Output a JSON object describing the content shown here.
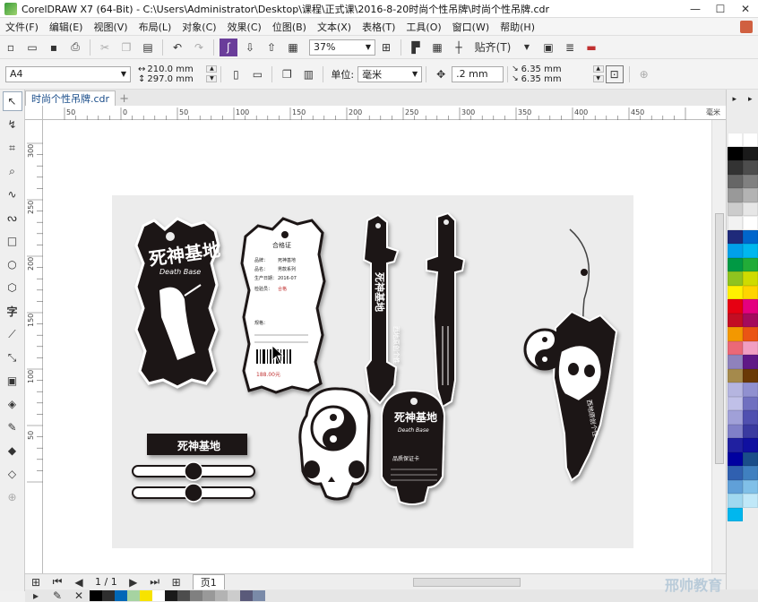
{
  "window": {
    "title": "CorelDRAW X7 (64-Bit) - C:\\Users\\Administrator\\Desktop\\课程\\正式课\\2016-8-20时尚个性吊牌\\时尚个性吊牌.cdr",
    "minimize": "—",
    "maximize": "☐",
    "close": "✕"
  },
  "menu": [
    "文件(F)",
    "编辑(E)",
    "视图(V)",
    "布局(L)",
    "对象(C)",
    "效果(C)",
    "位图(B)",
    "文本(X)",
    "表格(T)",
    "工具(O)",
    "窗口(W)",
    "帮助(H)"
  ],
  "toolbar": {
    "zoom": "37%",
    "snap": "贴齐(T)"
  },
  "property": {
    "paper": "A4",
    "width": "210.0 mm",
    "height": "297.0 mm",
    "unit_label": "单位:",
    "unit": "毫米",
    "nudge": ".2 mm",
    "dup_x": "6.35 mm",
    "dup_y": "6.35 mm"
  },
  "tabs": {
    "doc": "时尚个性吊牌.cdr"
  },
  "ruler": {
    "h_labels": [
      "50",
      "0",
      "50",
      "100",
      "150",
      "200",
      "250",
      "300",
      "350",
      "400",
      "450"
    ],
    "h_unit": "毫米",
    "v_labels": [
      "300",
      "250",
      "200",
      "150",
      "100",
      "50"
    ]
  },
  "status": {
    "page": "1 / 1",
    "page_tab": "页1"
  },
  "art": {
    "brand": "死神基地",
    "brand_en": "Death Base",
    "cert_title": "合格证",
    "cert_lines": [
      "品牌：",
      "死神基地",
      "品名：",
      "男款系列",
      "生产日期：",
      "2016-07",
      "检验员：",
      "合格",
      "规格："
    ],
    "price": "188.00元",
    "side_text": "西地原创个性",
    "vert_text": "街头潮流 个性态度",
    "warranty": "品质保证卡"
  },
  "watermark": "邢帅教育",
  "colors": {
    "accent": "#1a4d8a",
    "tag": "#1c1414"
  }
}
